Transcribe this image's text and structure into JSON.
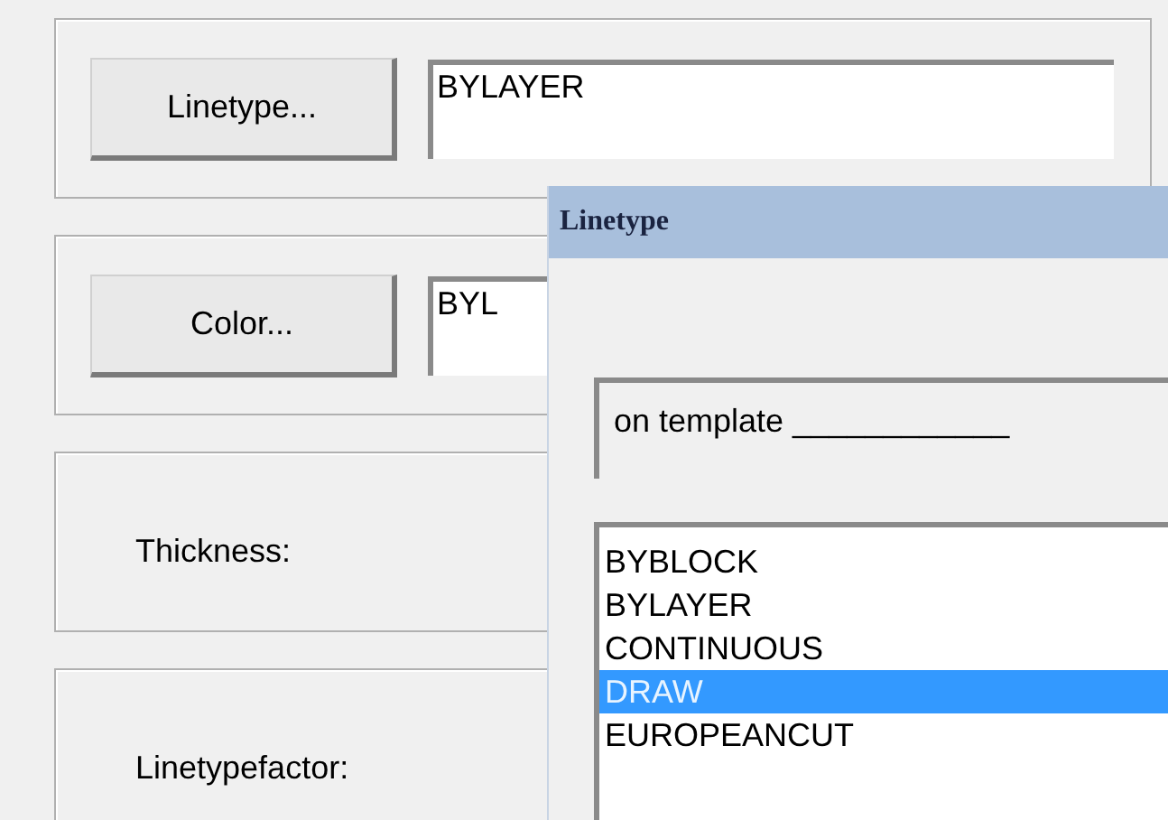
{
  "groups": [
    {
      "kind": "button",
      "button": "Linetype...",
      "value": "BYLAYER"
    },
    {
      "kind": "button",
      "button": "Color...",
      "value": "BYL"
    },
    {
      "kind": "label",
      "label": "Thickness:"
    },
    {
      "kind": "label",
      "label": "Linetypefactor:"
    }
  ],
  "dialog": {
    "title": "Linetype",
    "template": "on template ____________",
    "items": [
      {
        "label": "BYBLOCK",
        "selected": false
      },
      {
        "label": "BYLAYER",
        "selected": false
      },
      {
        "label": "CONTINUOUS",
        "selected": false
      },
      {
        "label": "DRAW",
        "selected": true
      },
      {
        "label": "EUROPEANCUT",
        "selected": false
      }
    ]
  }
}
